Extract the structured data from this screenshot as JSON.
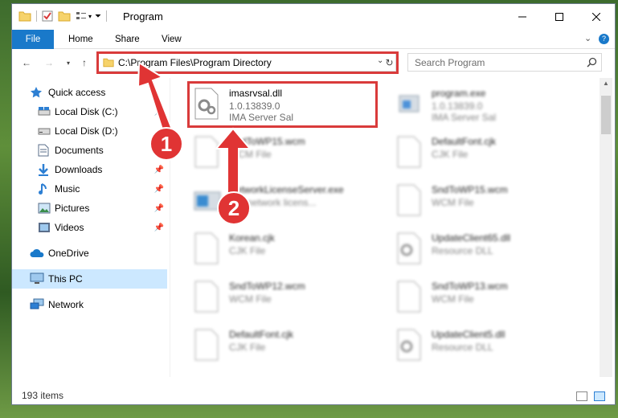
{
  "window": {
    "title": "Program",
    "minimize_icon": "minimize-icon",
    "maximize_icon": "maximize-icon",
    "close_icon": "close-icon"
  },
  "ribbon": {
    "tabs": [
      "File",
      "Home",
      "Share",
      "View"
    ]
  },
  "address_bar": {
    "path": "C:\\Program Files\\Program Directory"
  },
  "search": {
    "placeholder": "Search Program"
  },
  "nav_pane": {
    "items": [
      {
        "label": "Quick access",
        "icon": "star-icon"
      },
      {
        "label": "Local Disk (C:)",
        "icon": "drive-icon"
      },
      {
        "label": "Local Disk (D:)",
        "icon": "drive-icon"
      },
      {
        "label": "Documents",
        "icon": "documents-icon"
      },
      {
        "label": "Downloads",
        "icon": "download-icon"
      },
      {
        "label": "Music",
        "icon": "music-icon"
      },
      {
        "label": "Pictures",
        "icon": "pictures-icon"
      },
      {
        "label": "Videos",
        "icon": "videos-icon"
      },
      {
        "label": "OneDrive",
        "icon": "cloud-icon"
      },
      {
        "label": "This PC",
        "icon": "computer-icon"
      },
      {
        "label": "Network",
        "icon": "network-icon"
      }
    ]
  },
  "files": [
    {
      "name": "imasrvsal.dll",
      "line2": "1.0.13839.0",
      "line3": "IMA Server Sal",
      "icon": "dll-icon"
    },
    {
      "name": "program.exe",
      "line2": "1.0.13839.0",
      "line3": "IMA Server Sal",
      "icon": "exe-icon"
    },
    {
      "name": "SndToWP15.wcm",
      "line2": "WCM File",
      "line3": "",
      "icon": "file-icon"
    },
    {
      "name": "DefaultFont.cjk",
      "line2": "CJK File",
      "line3": "",
      "icon": "file-icon"
    },
    {
      "name": "NetworkLicenseServer.exe",
      "line2": "IBY network licens...",
      "line3": "",
      "icon": "exe-icon"
    },
    {
      "name": "SndToWP15.wcm",
      "line2": "WCM File",
      "line3": "",
      "icon": "file-icon"
    },
    {
      "name": "Korean.cjk",
      "line2": "CJK File",
      "line3": "",
      "icon": "file-icon"
    },
    {
      "name": "UpdateClient65.dll",
      "line2": "Resource DLL",
      "line3": "",
      "icon": "dll-icon"
    },
    {
      "name": "SndToWP12.wcm",
      "line2": "WCM File",
      "line3": "",
      "icon": "file-icon"
    },
    {
      "name": "SndToWP13.wcm",
      "line2": "WCM File",
      "line3": "",
      "icon": "file-icon"
    },
    {
      "name": "DefaultFont.cjk",
      "line2": "CJK File",
      "line3": "",
      "icon": "file-icon"
    },
    {
      "name": "UpdateClient5.dll",
      "line2": "Resource DLL",
      "line3": "",
      "icon": "dll-icon"
    }
  ],
  "status_bar": {
    "count": "193 items"
  },
  "callouts": [
    "1",
    "2"
  ],
  "colors": {
    "accent": "#1979ca",
    "highlight": "#d93b3b",
    "selected": "#cce8ff"
  }
}
